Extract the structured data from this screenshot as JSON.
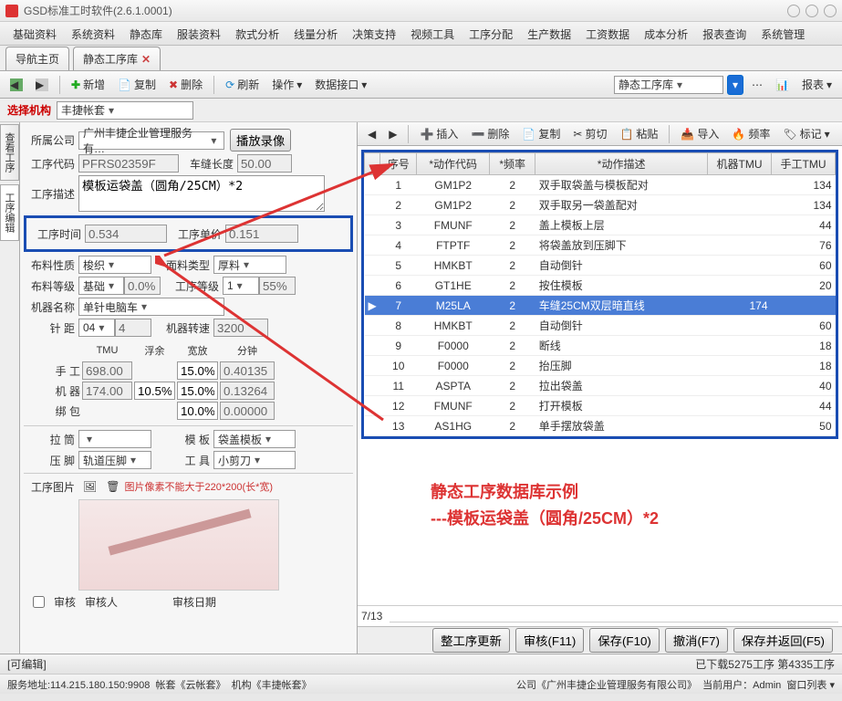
{
  "title": "GSD标准工时软件(2.6.1.0001)",
  "menubar": [
    "基础资料",
    "系统资料",
    "静态库",
    "服装资料",
    "款式分析",
    "线量分析",
    "决策支持",
    "视频工具",
    "工序分配",
    "生产数据",
    "工资数据",
    "成本分析",
    "报表查询",
    "系统管理"
  ],
  "tabs": {
    "nav": "导航主页",
    "current": "静态工序库"
  },
  "toolbar": {
    "new": "新增",
    "copy": "复制",
    "del": "删除",
    "refresh": "刷新",
    "op": "操作",
    "api": "数据接口",
    "lib": "静态工序库",
    "report": "报表"
  },
  "select_org": {
    "label": "选择机构",
    "value": "丰捷帐套"
  },
  "form": {
    "company_lbl": "所属公司",
    "company": "广州丰捷企业管理服务有…",
    "rec_btn": "播放录像",
    "code_lbl": "工序代码",
    "code": "PFRS02359F",
    "seam_len_lbl": "车缝长度",
    "seam_len": "50.00",
    "desc_lbl": "工序描述",
    "desc": "模板运袋盖（圆角/25CM）*2",
    "time_lbl": "工序时间",
    "time": "0.534",
    "price_lbl": "工序单价",
    "price": "0.151",
    "fabric_lbl": "布料性质",
    "fabric": "梭织",
    "facetype_lbl": "面料类型",
    "facetype": "厚料",
    "level_lbl": "布料等级",
    "level": "基础",
    "rate": "0.0%",
    "proc_level_lbl": "工序等级",
    "proc_level": "1",
    "pct": "55%",
    "machine_lbl": "机器名称",
    "machine": "单针电脑车",
    "needle_lbl": "针    距",
    "needle": "04",
    "needle2": "4",
    "rpm_lbl": "机器转速",
    "rpm": "3200",
    "cols": {
      "tmu": "TMU",
      "float": "浮余",
      "allow": "宽放",
      "min": "分钟"
    },
    "hand_lbl": "手    工",
    "hand_tmu": "698.00",
    "hand_allow": "15.0%",
    "hand_min": "0.40135",
    "mach_lbl": "机    器",
    "mach_tmu": "174.00",
    "mach_float": "10.5%",
    "mach_allow": "15.0%",
    "mach_min": "0.13264",
    "bind_lbl": "绑    包",
    "bind_allow": "10.0%",
    "bind_min": "0.00000",
    "drum_lbl": "拉    筒",
    "template_lbl": "模    板",
    "template": "袋盖模板",
    "foot_lbl": "压    脚",
    "foot": "轨道压脚",
    "tool_lbl": "工    具",
    "tool": "小剪刀",
    "pic_lbl": "工序图片",
    "pic_note": "图片像素不能大于220*200(长*宽)",
    "audit_lbl": "审核",
    "auditor": "审核人",
    "audit_date": "审核日期"
  },
  "rtoolbar": {
    "insert": "插入",
    "del": "删除",
    "copy": "复制",
    "cut": "剪切",
    "paste": "粘贴",
    "import": "导入",
    "freq": "频率",
    "mark": "标记"
  },
  "grid_headers": {
    "seq": "序号",
    "code": "*动作代码",
    "freq": "*频率",
    "desc": "*动作描述",
    "mtmu": "机器TMU",
    "htmu": "手工TMU"
  },
  "rows": [
    {
      "seq": 1,
      "code": "GM1P2",
      "freq": 2,
      "desc": "双手取袋盖与模板配对",
      "mtmu": "",
      "htmu": 134
    },
    {
      "seq": 2,
      "code": "GM1P2",
      "freq": 2,
      "desc": "双手取另一袋盖配对",
      "mtmu": "",
      "htmu": 134
    },
    {
      "seq": 3,
      "code": "FMUNF",
      "freq": 2,
      "desc": "盖上模板上层",
      "mtmu": "",
      "htmu": 44
    },
    {
      "seq": 4,
      "code": "FTPTF",
      "freq": 2,
      "desc": "将袋盖放到压脚下",
      "mtmu": "",
      "htmu": 76
    },
    {
      "seq": 5,
      "code": "HMKBT",
      "freq": 2,
      "desc": "自动倒针",
      "mtmu": "",
      "htmu": 60
    },
    {
      "seq": 6,
      "code": "GT1HE",
      "freq": 2,
      "desc": "按住模板",
      "mtmu": "",
      "htmu": 20
    },
    {
      "seq": 7,
      "code": "M25LA",
      "freq": 2,
      "desc": "车缝25CM双层暗直线",
      "mtmu": 174,
      "htmu": "",
      "sel": true
    },
    {
      "seq": 8,
      "code": "HMKBT",
      "freq": 2,
      "desc": "自动倒针",
      "mtmu": "",
      "htmu": 60
    },
    {
      "seq": 9,
      "code": "F0000",
      "freq": 2,
      "desc": "断线",
      "mtmu": "",
      "htmu": 18
    },
    {
      "seq": 10,
      "code": "F0000",
      "freq": 2,
      "desc": "抬压脚",
      "mtmu": "",
      "htmu": 18
    },
    {
      "seq": 11,
      "code": "ASPTA",
      "freq": 2,
      "desc": "拉出袋盖",
      "mtmu": "",
      "htmu": 40
    },
    {
      "seq": 12,
      "code": "FMUNF",
      "freq": 2,
      "desc": "打开模板",
      "mtmu": "",
      "htmu": 44
    },
    {
      "seq": 13,
      "code": "AS1HG",
      "freq": 2,
      "desc": "单手摆放袋盖",
      "mtmu": "",
      "htmu": 50
    }
  ],
  "page": "7/13",
  "annot1": "静态工序数据库示例",
  "annot2": "---模板运袋盖（圆角/25CM）*2",
  "btns": {
    "update": "整工序更新",
    "audit": "审核(F11)",
    "save": "保存(F10)",
    "cancel": "撤消(F7)",
    "savereturn": "保存并返回(F5)"
  },
  "status1_left": "[可编辑]",
  "status1_right": "已下载5275工序 第4335工序",
  "status2": {
    "addr": "服务地址:114.215.180.150:9908",
    "acct": "帐套《云帐套》",
    "org": "机构《丰捷帐套》",
    "company": "公司《广州丰捷企业管理服务有限公司》",
    "user": "当前用户：Admin",
    "winlist": "窗口列表"
  },
  "sidetabs": {
    "view": "查看工序",
    "edit": "工序编辑"
  }
}
